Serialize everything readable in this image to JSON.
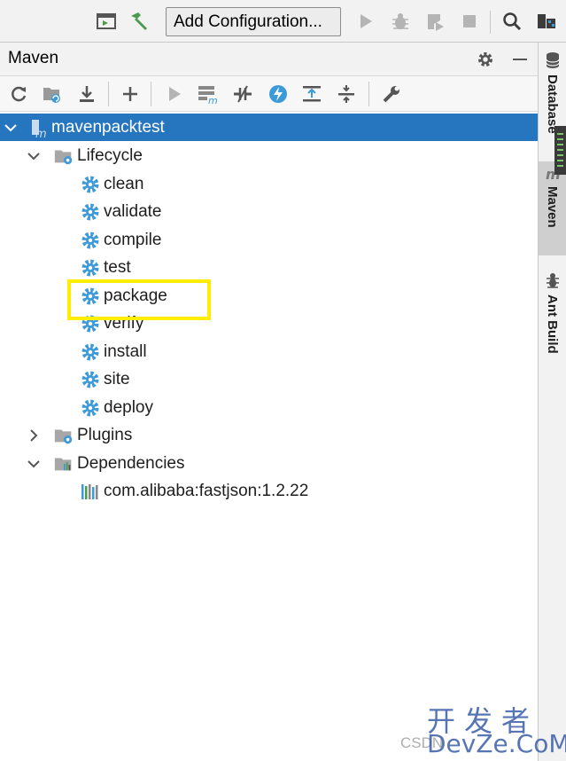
{
  "toolbar": {
    "config_label": "Add Configuration..."
  },
  "panel": {
    "title": "Maven"
  },
  "tree": {
    "project": "mavenpacktest",
    "lifecycle": "Lifecycle",
    "phases": [
      "clean",
      "validate",
      "compile",
      "test",
      "package",
      "verify",
      "install",
      "site",
      "deploy"
    ],
    "plugins": "Plugins",
    "dependencies": "Dependencies",
    "dependency_items": [
      "com.alibaba:fastjson:1.2.22"
    ]
  },
  "right_strip": {
    "tabs": [
      "Database",
      "Maven",
      "Ant Build"
    ]
  },
  "watermark": {
    "cn": "开发者",
    "en": "DevZe.CoM",
    "csdn": "CSDN"
  },
  "colors": {
    "selection": "#2675bf",
    "gear": "#3d9ad8",
    "highlight": "#ffee00",
    "run_disabled": "#b4b4b4"
  }
}
